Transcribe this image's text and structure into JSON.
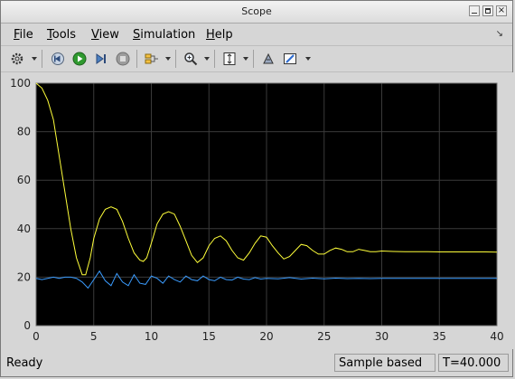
{
  "window": {
    "title": "Scope"
  },
  "menu": {
    "items": [
      {
        "label": "File",
        "accel": "F",
        "rest": "ile"
      },
      {
        "label": "Tools",
        "accel": "T",
        "rest": "ools"
      },
      {
        "label": "View",
        "accel": "V",
        "rest": "iew"
      },
      {
        "label": "Simulation",
        "accel": "S",
        "rest": "imulation"
      },
      {
        "label": "Help",
        "accel": "H",
        "rest": "elp"
      }
    ]
  },
  "toolbar": {
    "icons": [
      "settings-icon",
      "step-back-icon",
      "run-icon",
      "step-forward-icon",
      "stop-icon",
      "signal-select-icon",
      "zoom-icon",
      "autoscale-icon",
      "highlight-simulink-icon",
      "style-icon"
    ]
  },
  "status": {
    "ready": "Ready",
    "mode": "Sample based",
    "time": "T=40.000"
  },
  "colors": {
    "plot_bg": "#000000",
    "grid": "#3a3a3a",
    "axis_text": "#d0d0d0",
    "series_yellow": "#ffff3a",
    "series_blue": "#3a9cff"
  },
  "chart_data": {
    "type": "line",
    "title": "",
    "xlabel": "",
    "ylabel": "",
    "xlim": [
      0,
      40
    ],
    "ylim": [
      0,
      100
    ],
    "xticks": [
      0,
      5,
      10,
      15,
      20,
      25,
      30,
      35,
      40
    ],
    "yticks": [
      0,
      20,
      40,
      60,
      80,
      100
    ],
    "grid": true,
    "series": [
      {
        "color": "#ffff3a",
        "x": [
          0,
          0.5,
          1,
          1.5,
          2,
          2.5,
          3,
          3.5,
          4,
          4.3,
          4.7,
          5,
          5.5,
          6,
          6.5,
          7,
          7.5,
          8,
          8.5,
          9,
          9.3,
          9.6,
          10,
          10.5,
          11,
          11.5,
          12,
          12.5,
          13,
          13.5,
          14,
          14.5,
          15,
          15.5,
          16,
          16.5,
          17,
          17.5,
          18,
          18.5,
          19,
          19.5,
          20,
          20.5,
          21,
          21.5,
          22,
          22.5,
          23,
          23.5,
          24,
          24.5,
          25,
          25.5,
          26,
          26.5,
          27,
          27.5,
          28,
          28.5,
          29,
          29.5,
          30,
          31,
          32,
          33,
          34,
          35,
          36,
          37,
          38,
          39,
          40
        ],
        "y": [
          100,
          98,
          93,
          85,
          70,
          55,
          40,
          28,
          21,
          21,
          28,
          36,
          44,
          48,
          49,
          48,
          43,
          36,
          30,
          27,
          26.5,
          28,
          34,
          42,
          46,
          47,
          46,
          41,
          35,
          29,
          26,
          28,
          33,
          36,
          37,
          35,
          31,
          28,
          27,
          30,
          34,
          37,
          36.5,
          33,
          30,
          27.5,
          28.5,
          31,
          33.5,
          33,
          31,
          29.5,
          29.5,
          31,
          32,
          31.5,
          30.5,
          30.5,
          31.5,
          31,
          30.5,
          30.5,
          30.8,
          30.6,
          30.5,
          30.5,
          30.5,
          30.4,
          30.4,
          30.4,
          30.4,
          30.4,
          30.3
        ]
      },
      {
        "color": "#3a9cff",
        "x": [
          0,
          0.5,
          1,
          1.5,
          2,
          2.5,
          3,
          3.5,
          4,
          4.5,
          5,
          5.5,
          6,
          6.5,
          7,
          7.5,
          8,
          8.5,
          9,
          9.5,
          10,
          10.5,
          11,
          11.5,
          12,
          12.5,
          13,
          13.5,
          14,
          14.5,
          15,
          15.5,
          16,
          16.5,
          17,
          17.5,
          18,
          18.5,
          19,
          19.5,
          20,
          21,
          22,
          23,
          24,
          25,
          26,
          27,
          28,
          29,
          30,
          32,
          34,
          36,
          38,
          40
        ],
        "y": [
          19.5,
          19,
          19.5,
          20,
          19.5,
          20,
          20,
          19.5,
          18,
          15.5,
          19,
          22.5,
          18.5,
          16.5,
          21.5,
          18,
          16.5,
          21,
          17.5,
          17,
          20.5,
          19.5,
          17.5,
          20.5,
          19,
          18,
          20.5,
          19,
          18.5,
          20.5,
          19,
          18.5,
          20,
          19,
          18.8,
          20,
          19.2,
          19,
          19.8,
          19.2,
          19.5,
          19.3,
          19.8,
          19.2,
          19.6,
          19.3,
          19.6,
          19.4,
          19.5,
          19.4,
          19.5,
          19.5,
          19.5,
          19.5,
          19.5,
          19.5
        ]
      }
    ]
  }
}
